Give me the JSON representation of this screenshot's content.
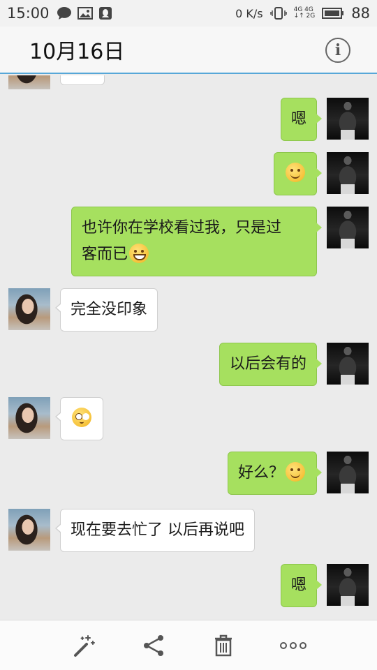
{
  "status_bar": {
    "time": "15:00",
    "speed": "0 K/s",
    "network": [
      "4G 4G",
      "↓↑ 2G"
    ],
    "battery": "88"
  },
  "header": {
    "title": "10月16日",
    "info_icon": "info-icon"
  },
  "messages": [
    {
      "from": "me",
      "text": "嗯"
    },
    {
      "from": "me",
      "emoji": "smile"
    },
    {
      "from": "me",
      "text_line1": "也许你在学校看过我，只是过",
      "text_line2": "客而已",
      "emoji": "grin"
    },
    {
      "from": "them",
      "text": "完全没印象"
    },
    {
      "from": "me",
      "text": "以后会有的"
    },
    {
      "from": "them",
      "emoji": "roll-eyes"
    },
    {
      "from": "me",
      "text": "好么？",
      "emoji": "smile"
    },
    {
      "from": "them",
      "text": "现在要去忙了 以后再说吧"
    },
    {
      "from": "me",
      "text": "嗯"
    }
  ],
  "toolbar": {
    "icons": [
      "magic-wand-icon",
      "share-icon",
      "trash-icon",
      "more-icon"
    ]
  },
  "colors": {
    "outgoing_bubble": "#a6e05f",
    "incoming_bubble": "#ffffff",
    "background": "#ebebeb",
    "header_border": "#57a7d8"
  }
}
